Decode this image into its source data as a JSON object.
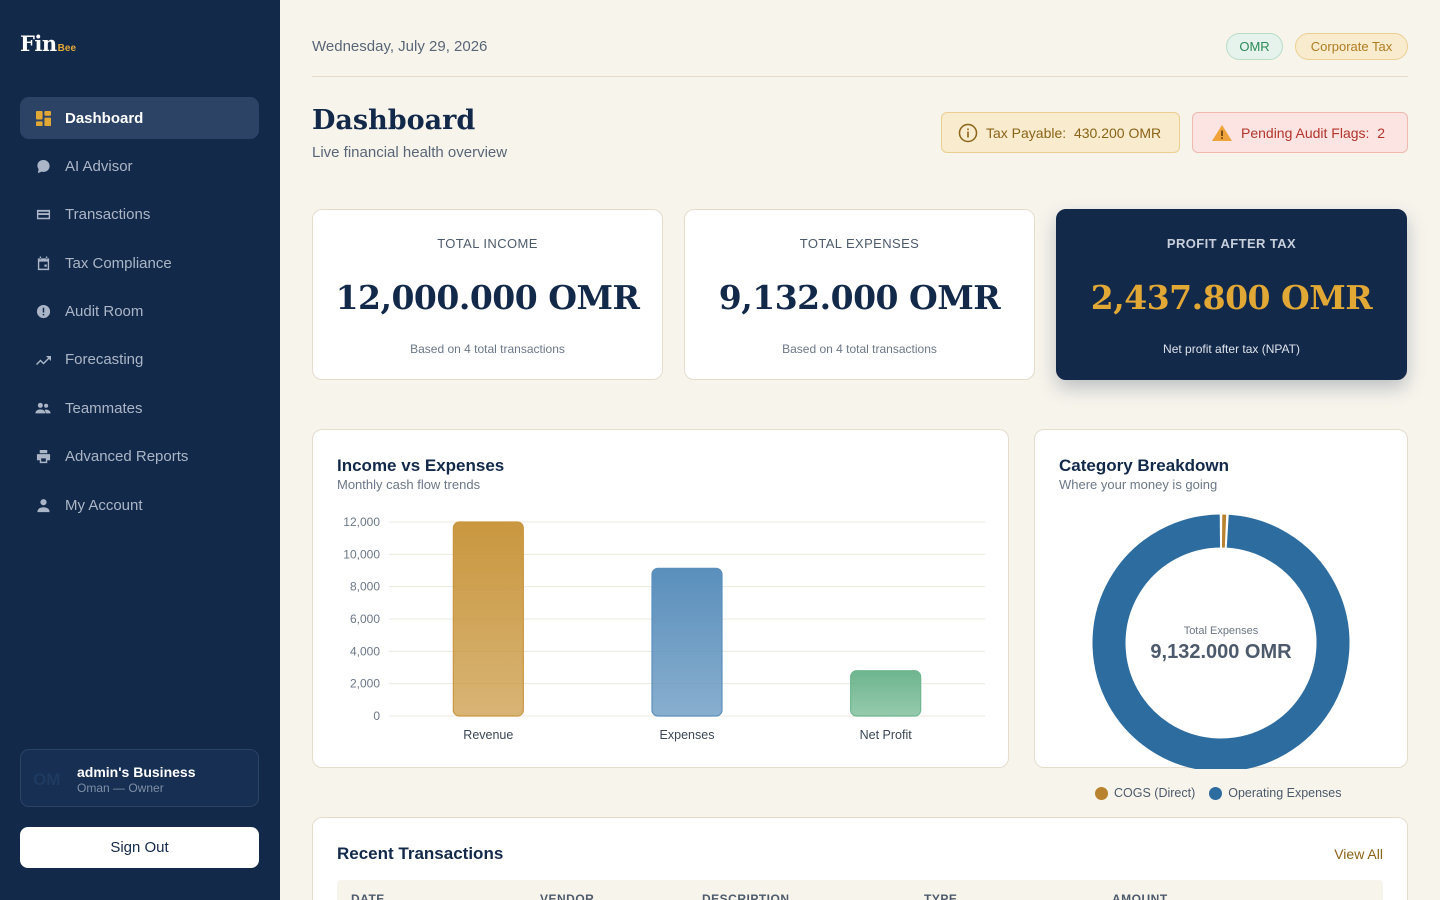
{
  "sidebar": {
    "logo_main": "Fin",
    "logo_sub": "Bee",
    "items": [
      {
        "label": "Dashboard",
        "icon": "dashboard-icon",
        "active": true
      },
      {
        "label": "AI Advisor",
        "icon": "chat-bubble-icon"
      },
      {
        "label": "Transactions",
        "icon": "credit-card-icon"
      },
      {
        "label": "Tax Compliance",
        "icon": "calendar-icon"
      },
      {
        "label": "Audit Room",
        "icon": "alert-circle-icon"
      },
      {
        "label": "Forecasting",
        "icon": "trending-up-icon"
      },
      {
        "label": "Teammates",
        "icon": "people-icon"
      },
      {
        "label": "Advanced Reports",
        "icon": "printer-icon"
      },
      {
        "label": "My Account",
        "icon": "person-icon"
      }
    ],
    "business": {
      "avatar": "OM",
      "name": "admin's Business",
      "role": "Oman — Owner"
    },
    "signout_label": "Sign Out"
  },
  "header": {
    "date": "Wednesday, July 29, 2026",
    "currency_badge": "OMR",
    "tax_badge": "Corporate Tax"
  },
  "page": {
    "title": "Dashboard",
    "subtitle": "Live financial health overview",
    "tax_payable_label": "Tax Payable:",
    "tax_payable_value": "430.200 OMR",
    "audit_flags_label": "Pending Audit Flags:",
    "audit_flags_value": "2"
  },
  "stats": [
    {
      "label": "TOTAL INCOME",
      "value": "12,000.000 OMR",
      "note": "Based on 4 total transactions"
    },
    {
      "label": "TOTAL EXPENSES",
      "value": "9,132.000 OMR",
      "note": "Based on 4 total transactions"
    },
    {
      "label": "PROFIT AFTER TAX",
      "value": "2,437.800 OMR",
      "note": "Net profit after tax (NPAT)"
    }
  ],
  "income_chart": {
    "title": "Income vs Expenses",
    "subtitle": "Monthly cash flow trends"
  },
  "donut_chart": {
    "title": "Category Breakdown",
    "subtitle": "Where your money is going",
    "center_label": "Total Expenses",
    "center_value": "9,132.000 OMR"
  },
  "chart_data": [
    {
      "type": "bar",
      "title": "Income vs Expenses",
      "categories": [
        "Revenue",
        "Expenses",
        "Net Profit"
      ],
      "values": [
        12000,
        9132,
        2800
      ],
      "colors": [
        "#c9973f",
        "#5a8fbc",
        "#6db58e"
      ],
      "ylim": [
        0,
        12000
      ],
      "yticks": [
        "0",
        "2,000",
        "4,000",
        "6,000",
        "8,000",
        "10,000",
        "12,000"
      ],
      "grid": true,
      "legend": "none"
    },
    {
      "type": "pie",
      "title": "Category Breakdown",
      "categories": [
        "COGS (Direct)",
        "Operating Expenses"
      ],
      "values": [
        0.8,
        99.2
      ],
      "colors": [
        "#b8822f",
        "#2d6c9f"
      ],
      "legend": "bottom"
    }
  ],
  "transactions": {
    "title": "Recent Transactions",
    "view_all": "View All",
    "columns": [
      "DATE",
      "VENDOR",
      "DESCRIPTION",
      "TYPE",
      "AMOUNT"
    ]
  }
}
